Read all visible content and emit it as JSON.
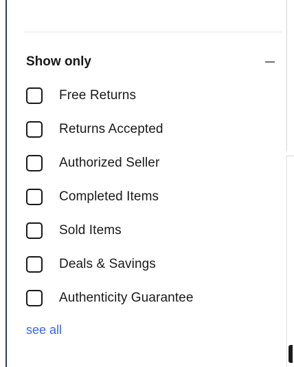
{
  "filter": {
    "title": "Show only",
    "collapse_icon": "minus-icon",
    "options": [
      {
        "label": "Free Returns",
        "checked": false
      },
      {
        "label": "Returns Accepted",
        "checked": false
      },
      {
        "label": "Authorized Seller",
        "checked": false
      },
      {
        "label": "Completed Items",
        "checked": false
      },
      {
        "label": "Sold Items",
        "checked": false
      },
      {
        "label": "Deals & Savings",
        "checked": false
      },
      {
        "label": "Authenticity Guarantee",
        "checked": false
      }
    ],
    "see_all_label": "see all"
  },
  "colors": {
    "text": "#191919",
    "link": "#3665f3",
    "sidebar_border": "#2f3b57",
    "divider": "#e6e6e6"
  }
}
